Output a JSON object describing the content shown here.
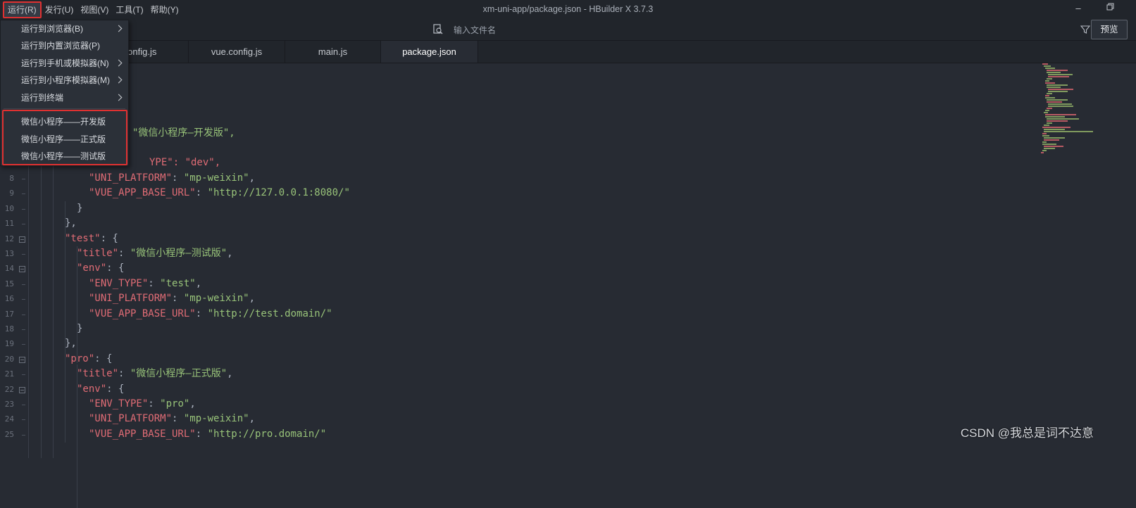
{
  "window": {
    "title": "xm-uni-app/package.json - HBuilder X 3.7.3"
  },
  "menu": [
    {
      "label": "运行(R)"
    },
    {
      "label": "发行(U)"
    },
    {
      "label": "视图(V)"
    },
    {
      "label": "工具(T)"
    },
    {
      "label": "帮助(Y)"
    }
  ],
  "toolbar": {
    "search_placeholder": "输入文件名",
    "preview_label": "预览"
  },
  "tabs": [
    {
      "label": "config.js"
    },
    {
      "label": "vue.config.js"
    },
    {
      "label": "main.js"
    },
    {
      "label": "package.json"
    }
  ],
  "run_menu": {
    "items": [
      {
        "label": "运行到浏览器(B)"
      },
      {
        "label": "运行到内置浏览器(P)"
      },
      {
        "label": "运行到手机或模拟器(N)"
      },
      {
        "label": "运行到小程序模拟器(M)"
      },
      {
        "label": "运行到终端"
      }
    ],
    "custom_items": [
      {
        "label": "微信小程序——开发版"
      },
      {
        "label": "微信小程序——正式版"
      },
      {
        "label": "微信小程序——测试版"
      }
    ]
  },
  "editor": {
    "line_numbers": [
      "8",
      "9",
      "10",
      "11",
      "12",
      "13",
      "14",
      "15",
      "16",
      "17",
      "18",
      "19",
      "20",
      "21",
      "22",
      "23",
      "24",
      "25"
    ],
    "visible_title_value": "\"微信小程序—开发版\",",
    "line7_fragment": "YPE\": \"dev\",",
    "code": [
      {
        "key": "\"UNI_PLATFORM\"",
        "sep": ": ",
        "val": "\"mp-weixin\"",
        "end": ","
      },
      {
        "key": "\"VUE_APP_BASE_URL\"",
        "sep": ": ",
        "val": "\"http://127.0.0.1:8080/\"",
        "end": ""
      },
      {
        "key": "",
        "sep": "}",
        "val": "",
        "end": ""
      },
      {
        "key": "",
        "sep": "},",
        "val": "",
        "end": ""
      },
      {
        "key": "\"test\"",
        "sep": ": {",
        "val": "",
        "end": ""
      },
      {
        "key": "\"title\"",
        "sep": ": ",
        "val": "\"微信小程序—测试版\"",
        "end": ","
      },
      {
        "key": "\"env\"",
        "sep": ": {",
        "val": "",
        "end": ""
      },
      {
        "key": "\"ENV_TYPE\"",
        "sep": ": ",
        "val": "\"test\"",
        "end": ","
      },
      {
        "key": "\"UNI_PLATFORM\"",
        "sep": ": ",
        "val": "\"mp-weixin\"",
        "end": ","
      },
      {
        "key": "\"VUE_APP_BASE_URL\"",
        "sep": ": ",
        "val": "\"http://test.domain/\"",
        "end": ""
      },
      {
        "key": "",
        "sep": "}",
        "val": "",
        "end": ""
      },
      {
        "key": "",
        "sep": "},",
        "val": "",
        "end": ""
      },
      {
        "key": "\"pro\"",
        "sep": ": {",
        "val": "",
        "end": ""
      },
      {
        "key": "\"title\"",
        "sep": ": ",
        "val": "\"微信小程序—正式版\"",
        "end": ","
      },
      {
        "key": "\"env\"",
        "sep": ": {",
        "val": "",
        "end": ""
      },
      {
        "key": "\"ENV_TYPE\"",
        "sep": ": ",
        "val": "\"pro\"",
        "end": ","
      },
      {
        "key": "\"UNI_PLATFORM\"",
        "sep": ": ",
        "val": "\"mp-weixin\"",
        "end": ","
      },
      {
        "key": "\"VUE_APP_BASE_URL\"",
        "sep": ": ",
        "val": "\"http://pro.domain/\"",
        "end": ""
      }
    ]
  },
  "watermark": "CSDN @我总是词不达意",
  "colors": {
    "menu_highlight": "#e03131",
    "key": "#e06c75",
    "string": "#98c379",
    "background": "#272b33"
  }
}
